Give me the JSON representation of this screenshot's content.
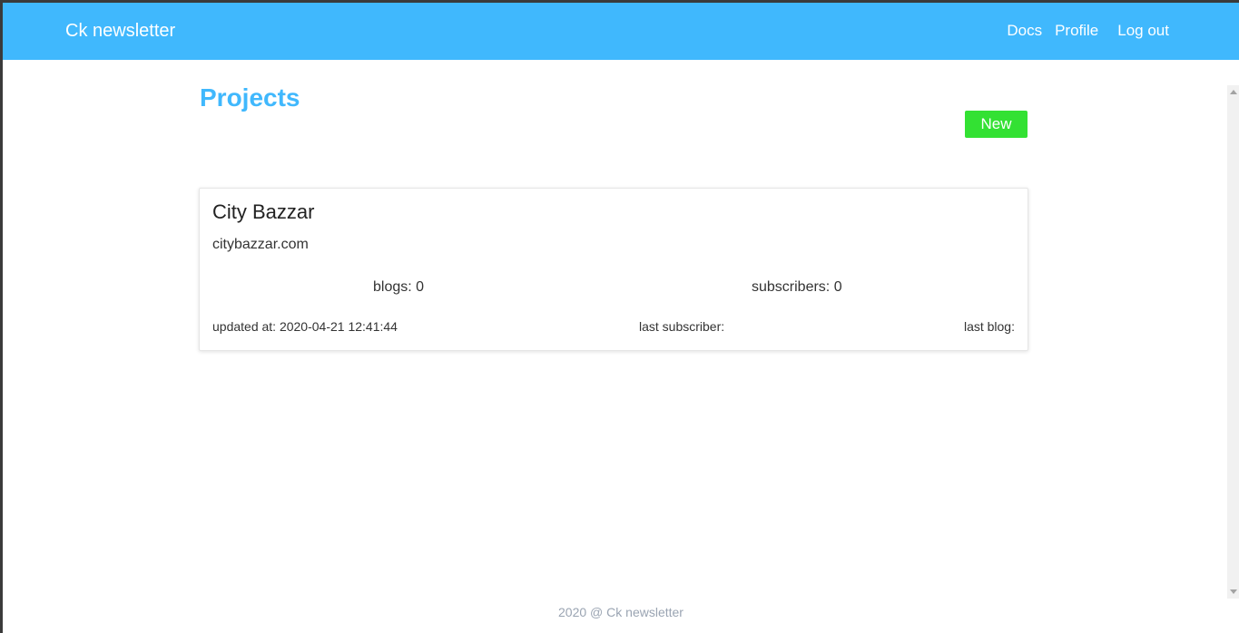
{
  "navbar": {
    "brand": "Ck newsletter",
    "links": {
      "docs": "Docs",
      "profile": "Profile",
      "logout": "Log out"
    },
    "background_color": "#40b8fd"
  },
  "main": {
    "title": "Projects",
    "new_button_label": "New",
    "new_button_color": "#33e133",
    "projects": [
      {
        "name": "City Bazzar",
        "url": "citybazzar.com",
        "blogs": "blogs: 0",
        "subscribers": "subscribers: 0",
        "updated_at": "updated at: 2020-04-21 12:41:44",
        "last_subscriber": "last subscriber:",
        "last_blog": "last blog:"
      }
    ]
  },
  "footer": {
    "text": "2020 @ Ck newsletter"
  }
}
